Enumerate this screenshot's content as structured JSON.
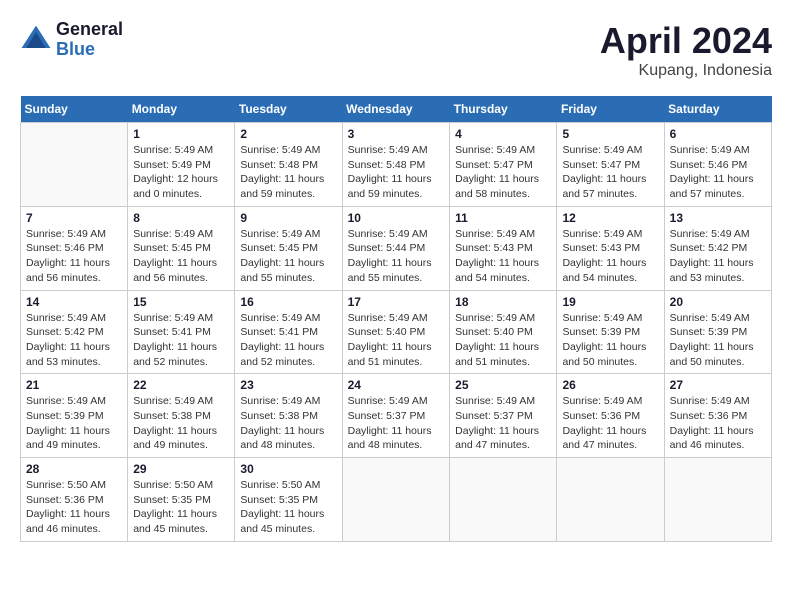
{
  "header": {
    "logo": {
      "general": "General",
      "blue": "Blue"
    },
    "title": "April 2024",
    "location": "Kupang, Indonesia"
  },
  "calendar": {
    "headers": [
      "Sunday",
      "Monday",
      "Tuesday",
      "Wednesday",
      "Thursday",
      "Friday",
      "Saturday"
    ],
    "weeks": [
      [
        {
          "day": "",
          "info": ""
        },
        {
          "day": "1",
          "info": "Sunrise: 5:49 AM\nSunset: 5:49 PM\nDaylight: 12 hours\nand 0 minutes."
        },
        {
          "day": "2",
          "info": "Sunrise: 5:49 AM\nSunset: 5:48 PM\nDaylight: 11 hours\nand 59 minutes."
        },
        {
          "day": "3",
          "info": "Sunrise: 5:49 AM\nSunset: 5:48 PM\nDaylight: 11 hours\nand 59 minutes."
        },
        {
          "day": "4",
          "info": "Sunrise: 5:49 AM\nSunset: 5:47 PM\nDaylight: 11 hours\nand 58 minutes."
        },
        {
          "day": "5",
          "info": "Sunrise: 5:49 AM\nSunset: 5:47 PM\nDaylight: 11 hours\nand 57 minutes."
        },
        {
          "day": "6",
          "info": "Sunrise: 5:49 AM\nSunset: 5:46 PM\nDaylight: 11 hours\nand 57 minutes."
        }
      ],
      [
        {
          "day": "7",
          "info": "Sunrise: 5:49 AM\nSunset: 5:46 PM\nDaylight: 11 hours\nand 56 minutes."
        },
        {
          "day": "8",
          "info": "Sunrise: 5:49 AM\nSunset: 5:45 PM\nDaylight: 11 hours\nand 56 minutes."
        },
        {
          "day": "9",
          "info": "Sunrise: 5:49 AM\nSunset: 5:45 PM\nDaylight: 11 hours\nand 55 minutes."
        },
        {
          "day": "10",
          "info": "Sunrise: 5:49 AM\nSunset: 5:44 PM\nDaylight: 11 hours\nand 55 minutes."
        },
        {
          "day": "11",
          "info": "Sunrise: 5:49 AM\nSunset: 5:43 PM\nDaylight: 11 hours\nand 54 minutes."
        },
        {
          "day": "12",
          "info": "Sunrise: 5:49 AM\nSunset: 5:43 PM\nDaylight: 11 hours\nand 54 minutes."
        },
        {
          "day": "13",
          "info": "Sunrise: 5:49 AM\nSunset: 5:42 PM\nDaylight: 11 hours\nand 53 minutes."
        }
      ],
      [
        {
          "day": "14",
          "info": "Sunrise: 5:49 AM\nSunset: 5:42 PM\nDaylight: 11 hours\nand 53 minutes."
        },
        {
          "day": "15",
          "info": "Sunrise: 5:49 AM\nSunset: 5:41 PM\nDaylight: 11 hours\nand 52 minutes."
        },
        {
          "day": "16",
          "info": "Sunrise: 5:49 AM\nSunset: 5:41 PM\nDaylight: 11 hours\nand 52 minutes."
        },
        {
          "day": "17",
          "info": "Sunrise: 5:49 AM\nSunset: 5:40 PM\nDaylight: 11 hours\nand 51 minutes."
        },
        {
          "day": "18",
          "info": "Sunrise: 5:49 AM\nSunset: 5:40 PM\nDaylight: 11 hours\nand 51 minutes."
        },
        {
          "day": "19",
          "info": "Sunrise: 5:49 AM\nSunset: 5:39 PM\nDaylight: 11 hours\nand 50 minutes."
        },
        {
          "day": "20",
          "info": "Sunrise: 5:49 AM\nSunset: 5:39 PM\nDaylight: 11 hours\nand 50 minutes."
        }
      ],
      [
        {
          "day": "21",
          "info": "Sunrise: 5:49 AM\nSunset: 5:39 PM\nDaylight: 11 hours\nand 49 minutes."
        },
        {
          "day": "22",
          "info": "Sunrise: 5:49 AM\nSunset: 5:38 PM\nDaylight: 11 hours\nand 49 minutes."
        },
        {
          "day": "23",
          "info": "Sunrise: 5:49 AM\nSunset: 5:38 PM\nDaylight: 11 hours\nand 48 minutes."
        },
        {
          "day": "24",
          "info": "Sunrise: 5:49 AM\nSunset: 5:37 PM\nDaylight: 11 hours\nand 48 minutes."
        },
        {
          "day": "25",
          "info": "Sunrise: 5:49 AM\nSunset: 5:37 PM\nDaylight: 11 hours\nand 47 minutes."
        },
        {
          "day": "26",
          "info": "Sunrise: 5:49 AM\nSunset: 5:36 PM\nDaylight: 11 hours\nand 47 minutes."
        },
        {
          "day": "27",
          "info": "Sunrise: 5:49 AM\nSunset: 5:36 PM\nDaylight: 11 hours\nand 46 minutes."
        }
      ],
      [
        {
          "day": "28",
          "info": "Sunrise: 5:50 AM\nSunset: 5:36 PM\nDaylight: 11 hours\nand 46 minutes."
        },
        {
          "day": "29",
          "info": "Sunrise: 5:50 AM\nSunset: 5:35 PM\nDaylight: 11 hours\nand 45 minutes."
        },
        {
          "day": "30",
          "info": "Sunrise: 5:50 AM\nSunset: 5:35 PM\nDaylight: 11 hours\nand 45 minutes."
        },
        {
          "day": "",
          "info": ""
        },
        {
          "day": "",
          "info": ""
        },
        {
          "day": "",
          "info": ""
        },
        {
          "day": "",
          "info": ""
        }
      ]
    ]
  }
}
